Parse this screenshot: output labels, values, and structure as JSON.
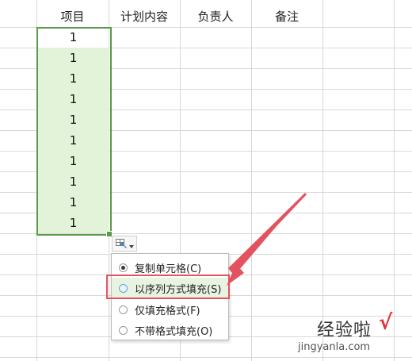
{
  "columns": [
    "项目",
    "计划内容",
    "负责人",
    "备注"
  ],
  "cells": [
    "1",
    "1",
    "1",
    "1",
    "1",
    "1",
    "1",
    "1",
    "1",
    "1"
  ],
  "autofill": {
    "icon": "autofill-options-icon",
    "dropdown_icon": "triangle-down-icon"
  },
  "menu": {
    "items": [
      {
        "label": "复制单元格(C)",
        "checked": true
      },
      {
        "label": "以序列方式填充(S)",
        "checked": false,
        "highlighted": true
      },
      {
        "label": "仅填充格式(F)",
        "checked": false
      },
      {
        "label": "不带格式填充(O)",
        "checked": false
      }
    ]
  },
  "watermark": {
    "logo": "经验啦",
    "url": "jingyanla.com",
    "check": "√"
  },
  "colors": {
    "selection_border": "#5a9a48",
    "selection_fill": "#e3f3da",
    "annotation": "#e3535f"
  }
}
